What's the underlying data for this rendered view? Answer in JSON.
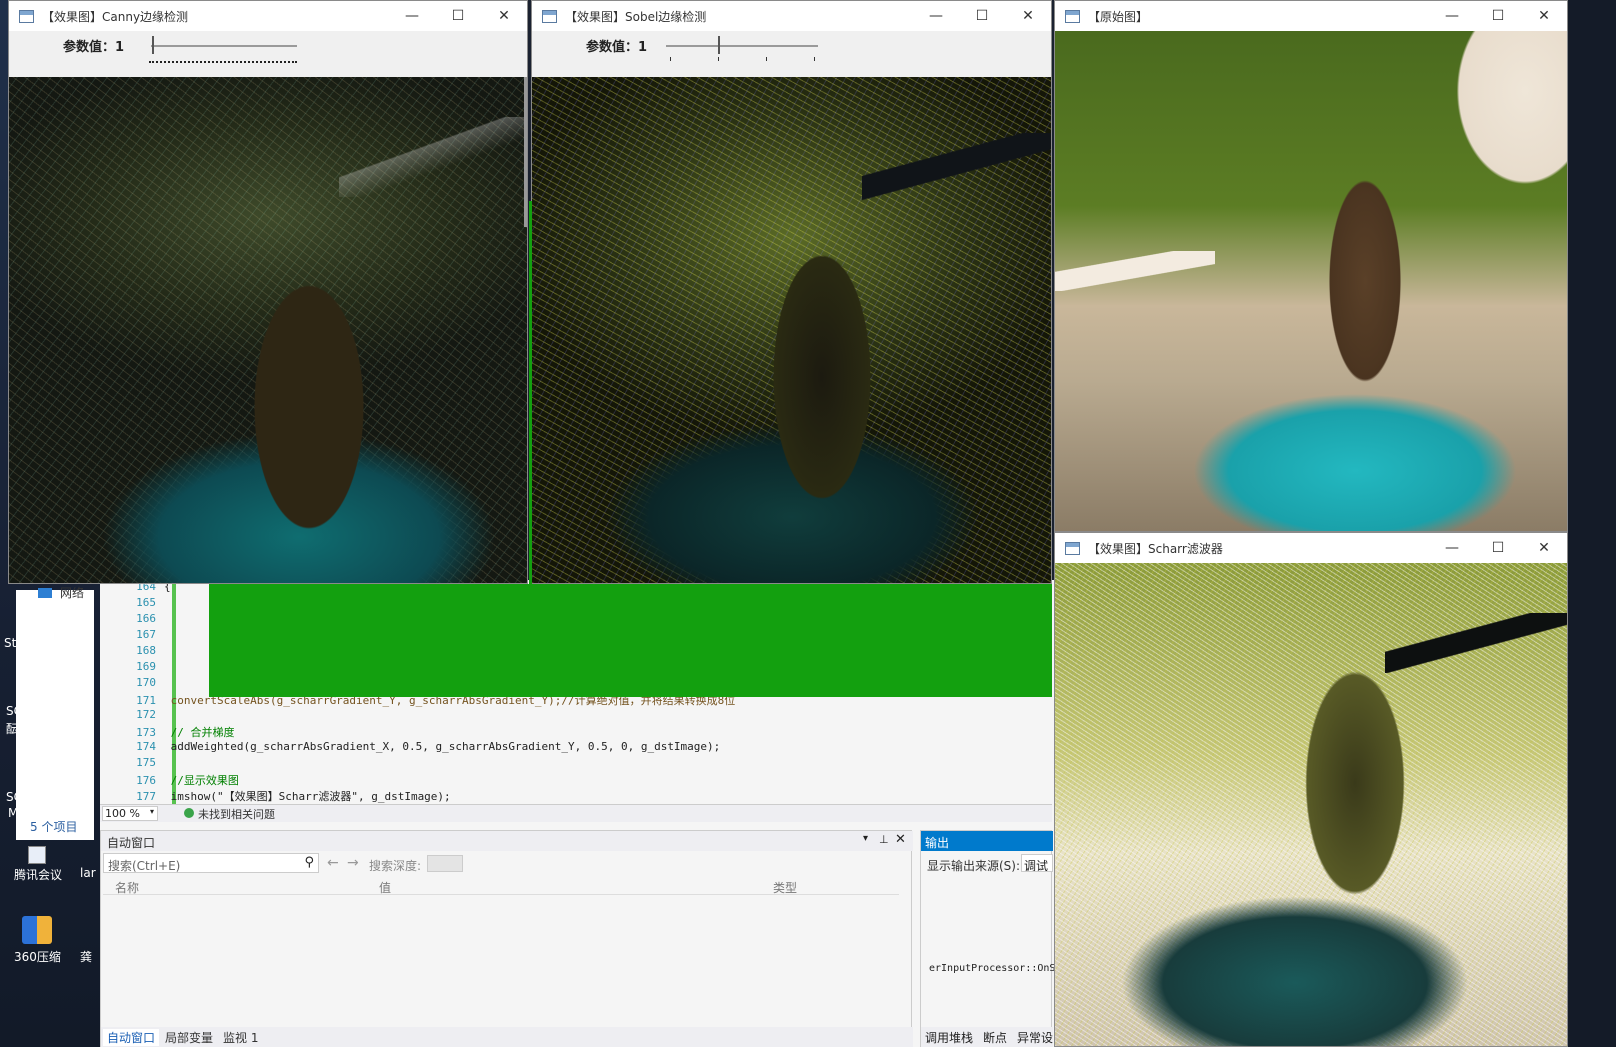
{
  "desktop": {
    "icons": [
      {
        "label": "网络"
      },
      {
        "label": "5 个项目"
      },
      {
        "label": "腾讯会议"
      },
      {
        "label": "lar"
      },
      {
        "label": "360压缩"
      },
      {
        "label": "龚"
      }
    ],
    "side_fragments": [
      "Stu",
      "SC",
      "酝",
      "SC",
      "M"
    ]
  },
  "windows": {
    "canny": {
      "title": "【效果图】Canny边缘检测",
      "param_label": "参数值：1",
      "minimize": "—",
      "maximize": "☐",
      "close": "✕"
    },
    "sobel": {
      "title": "【效果图】Sobel边缘检测",
      "param_label": "参数值：1",
      "minimize": "—",
      "maximize": "☐",
      "close": "✕"
    },
    "original": {
      "title": "【原始图】",
      "minimize": "—",
      "maximize": "☐",
      "close": "✕"
    },
    "scharr": {
      "title": "【效果图】Scharr滤波器",
      "minimize": "—",
      "maximize": "☐",
      "close": "✕"
    }
  },
  "ide": {
    "lines": [
      {
        "num": "164",
        "code": "{"
      },
      {
        "num": "165",
        "code": ""
      },
      {
        "num": "166",
        "code": ""
      },
      {
        "num": "167",
        "code": ""
      },
      {
        "num": "168",
        "code": ""
      },
      {
        "num": "169",
        "code": ""
      },
      {
        "num": "170",
        "code": ""
      },
      {
        "num": "171",
        "code": "    convertScaleAbs(g_scharrGradient_Y, g_scharrAbsGradient_Y);//计算绝对值，并将结果转换成8位"
      },
      {
        "num": "172",
        "code": ""
      },
      {
        "num": "173",
        "code": "    // 合并梯度"
      },
      {
        "num": "174",
        "code": "    addWeighted(g_scharrAbsGradient_X, 0.5, g_scharrAbsGradient_Y, 0.5, 0, g_dstImage);"
      },
      {
        "num": "175",
        "code": ""
      },
      {
        "num": "176",
        "code": "    //显示效果图"
      },
      {
        "num": "177",
        "code": "    imshow(\"【效果图】Scharr滤波器\", g_dstImage);"
      }
    ],
    "zoom": "100 %",
    "status": "未找到相关问题",
    "autos": {
      "title": "自动窗口",
      "search_placeholder": "搜索(Ctrl+E)",
      "depth_label": "搜索深度:",
      "col_name": "名称",
      "col_value": "值",
      "col_type": "类型",
      "tabs": [
        "自动窗口",
        "局部变量",
        "监视 1"
      ]
    },
    "output": {
      "title": "输出",
      "source_label": "显示输出来源(S):",
      "source_value": "调试",
      "text": "erInputProcessor::OnS",
      "tabs": [
        "调用堆栈",
        "断点",
        "异常设"
      ]
    }
  },
  "colors": {
    "accent_green": "#13a00f",
    "vs_blue": "#007acc"
  }
}
